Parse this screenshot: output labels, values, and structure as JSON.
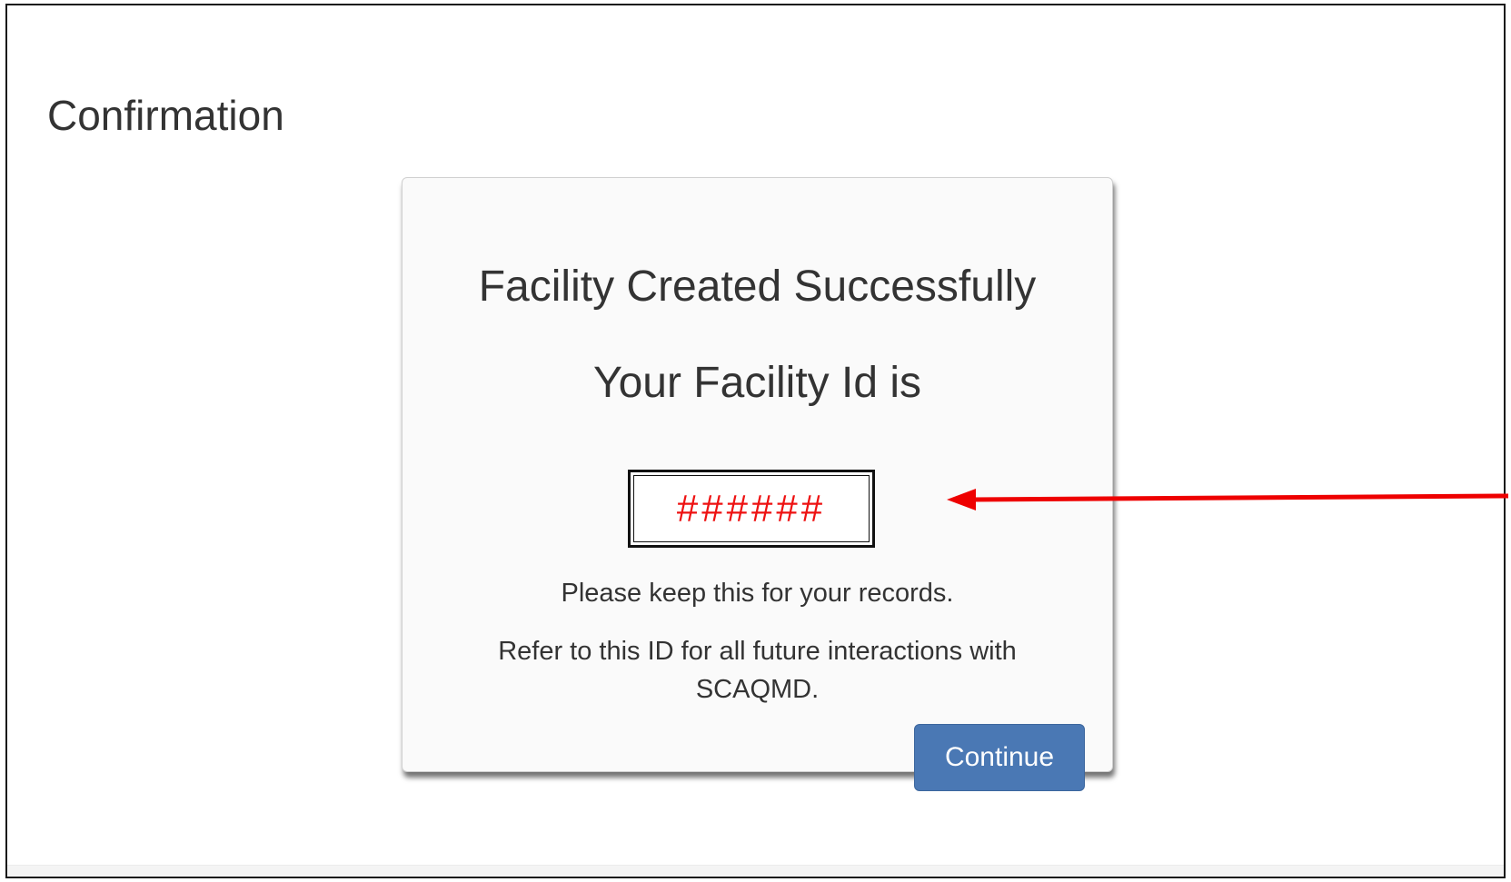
{
  "page": {
    "title": "Confirmation"
  },
  "card": {
    "heading": "Facility Created Successfully",
    "subheading": "Your Facility Id is",
    "facility_id": "######",
    "note_keep": "Please keep this for your records.",
    "note_refer": "Refer to this ID for all future interactions with SCAQMD."
  },
  "actions": {
    "continue_label": "Continue"
  },
  "colors": {
    "accent_button": "#4a78b4",
    "id_text": "#ee1111",
    "annotation_arrow": "#ee0000"
  },
  "annotations": {
    "arrow_icon": "left-arrow-icon"
  }
}
